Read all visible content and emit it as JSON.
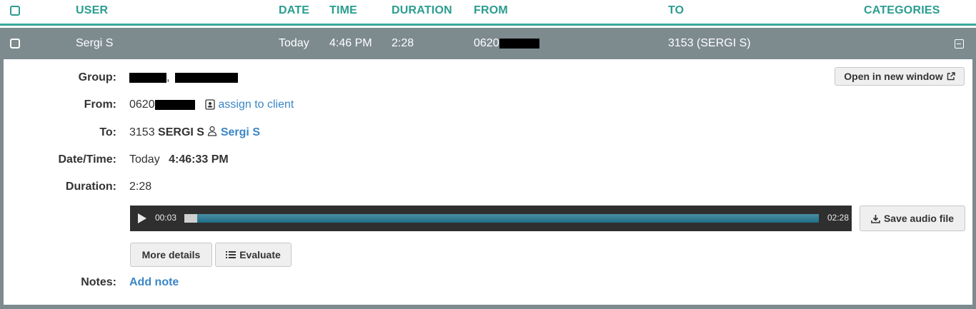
{
  "header": {
    "user": "USER",
    "date": "DATE",
    "time": "TIME",
    "duration": "DURATION",
    "from": "FROM",
    "to": "TO",
    "categories": "CATEGORIES"
  },
  "row": {
    "user": "Sergi S",
    "date": "Today",
    "time": "4:46 PM",
    "duration": "2:28",
    "from_prefix": "0620",
    "to": "3153 (SERGI S)"
  },
  "details": {
    "open_new_window": "Open in new window",
    "group_label": "Group:",
    "group_separator": ",",
    "from_label": "From:",
    "from_prefix": "0620",
    "assign_to_client": "assign to client",
    "to_label": "To:",
    "to_ext": "3153",
    "to_name": "SERGI S",
    "to_user_link": "Sergi S",
    "datetime_label": "Date/Time:",
    "date": "Today",
    "time": "4:46:33 PM",
    "duration_label": "Duration:",
    "duration": "2:28",
    "notes_label": "Notes:",
    "add_note": "Add note"
  },
  "player": {
    "current_time": "00:03",
    "total_time": "02:28",
    "progress": 0.02
  },
  "buttons": {
    "save_audio": "Save audio file",
    "more_details": "More details",
    "evaluate": "Evaluate"
  },
  "icons": {
    "external_link": "external-link-icon",
    "contact_card": "contact-card-icon",
    "user": "user-icon",
    "play": "play-icon",
    "download": "download-icon",
    "list": "list-icon",
    "collapse": "collapse-icon"
  },
  "colors": {
    "accent": "#2a9d8f",
    "row_bg": "#7d8b8f",
    "link": "#3a86c8"
  }
}
